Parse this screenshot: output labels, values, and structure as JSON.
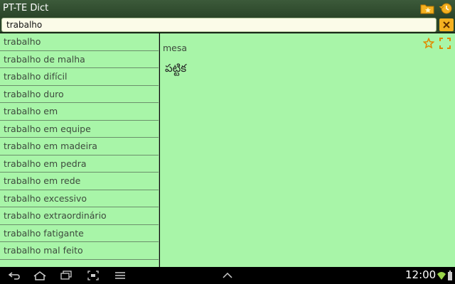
{
  "app": {
    "title": "PT-TE Dict",
    "accent_color": "#f4b120"
  },
  "search": {
    "value": "trabalho"
  },
  "word_list": [
    "trabalho",
    "trabalho de malha",
    "trabalho difícil",
    "trabalho duro",
    "trabalho em",
    "trabalho em equipe",
    "trabalho em madeira",
    "trabalho em pedra",
    "trabalho em rede",
    "trabalho excessivo",
    "trabalho extraordinário",
    "trabalho fatigante",
    "trabalho mal feito"
  ],
  "entry": {
    "word": "mesa",
    "translation": "పట్టిక"
  },
  "icons": {
    "bookmarks": "folder-star-icon",
    "history": "history-icon",
    "clear": "clear-icon",
    "favorite": "star-icon",
    "fullscreen": "expand-icon"
  },
  "system_bar": {
    "time": "12:00"
  }
}
